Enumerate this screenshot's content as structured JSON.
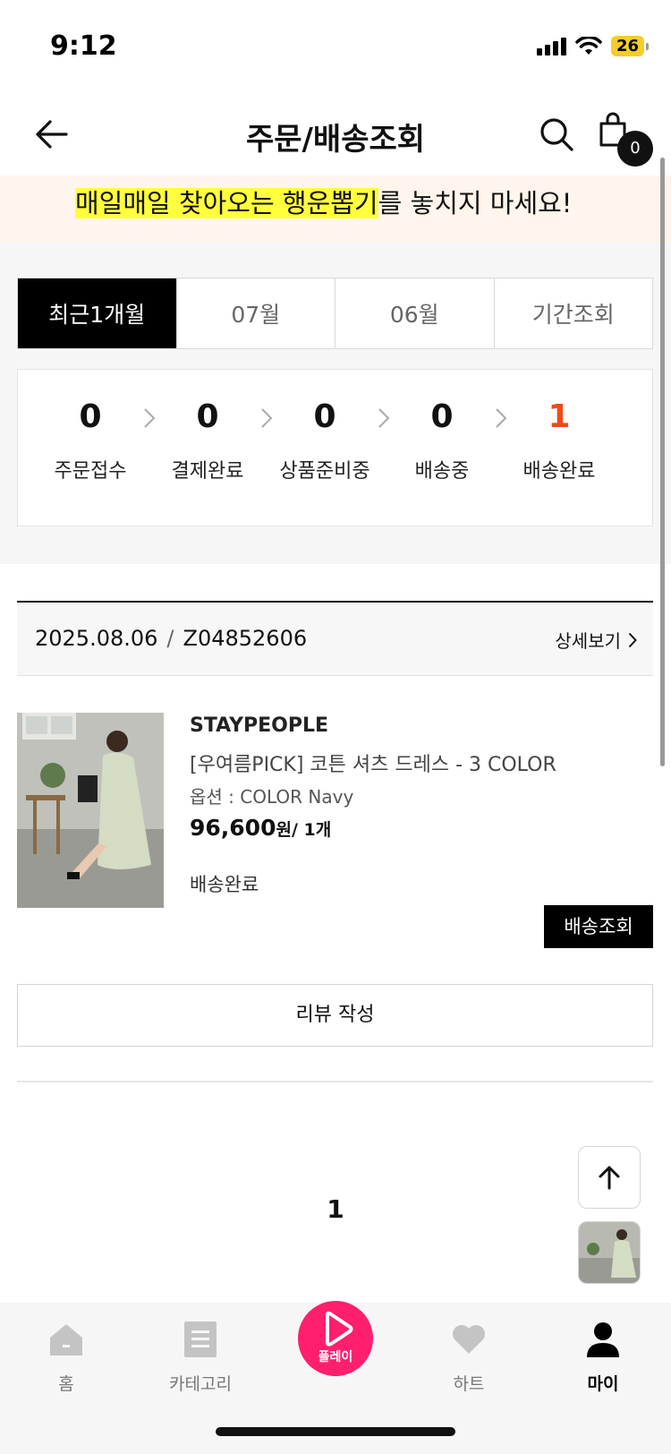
{
  "status_bar": {
    "time": "9:12",
    "battery": "26"
  },
  "header": {
    "title": "주문/배송조회",
    "cart_count": "0"
  },
  "banner": {
    "text_highlight": "매일매일 찾아오는 행운뽑기",
    "text_rest": "를 놓치지 마세요!"
  },
  "period_tabs": [
    "최근1개월",
    "07월",
    "06월",
    "기간조회"
  ],
  "active_period_tab": "최근1개월",
  "order_status": [
    {
      "count": "0",
      "label": "주문접수"
    },
    {
      "count": "0",
      "label": "결제완료"
    },
    {
      "count": "0",
      "label": "상품준비중"
    },
    {
      "count": "0",
      "label": "배송중"
    },
    {
      "count": "1",
      "label": "배송완료"
    }
  ],
  "accent_color": "#f14a1a",
  "order": {
    "date": "2025.08.06",
    "separator": "/",
    "order_no": "Z04852606",
    "detail_label": "상세보기",
    "item": {
      "brand": "STAYPEOPLE",
      "name": "[우여름PICK] 코튼 셔츠 드레스 - 3 COLOR",
      "option": "옵션 : COLOR Navy",
      "price": "96,600",
      "price_unit": "원",
      "quantity": "/ 1개",
      "status": "배송완료",
      "track_label": "배송조회"
    },
    "review_label": "리뷰 작성"
  },
  "pagination": {
    "current": "1"
  },
  "bottom_nav": [
    {
      "label": "홈",
      "icon": "home-icon"
    },
    {
      "label": "카테고리",
      "icon": "category-icon"
    },
    {
      "label": "플레이",
      "icon": "play-icon"
    },
    {
      "label": "하트",
      "icon": "heart-icon"
    },
    {
      "label": "마이",
      "icon": "person-icon"
    }
  ],
  "active_nav": "마이"
}
